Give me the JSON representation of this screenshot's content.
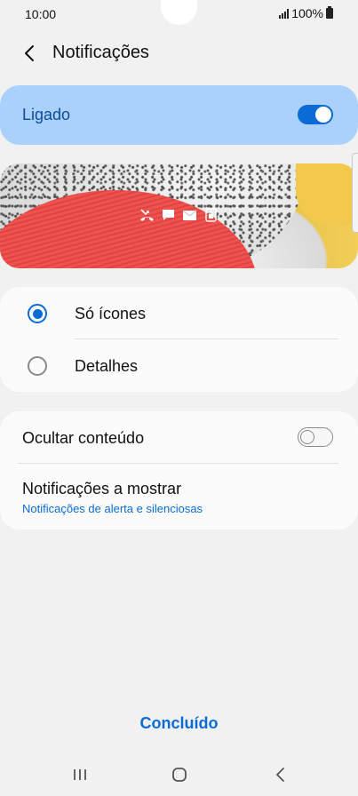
{
  "status_bar": {
    "time": "10:00",
    "battery_text": "100%",
    "signal_icon": "signal-icon",
    "battery_icon": "battery-icon"
  },
  "header": {
    "title": "Notificações",
    "back_icon": "back-arrow-icon"
  },
  "master_switch": {
    "label": "Ligado",
    "state": "on",
    "accent": "#0b6bd6",
    "background": "#a9d1fb"
  },
  "preview": {
    "icons": [
      "missed-call-icon",
      "chat-icon",
      "email-icon",
      "lock-icon"
    ]
  },
  "style_options": {
    "items": [
      {
        "label": "Só ícones",
        "checked": true
      },
      {
        "label": "Detalhes",
        "checked": false
      }
    ]
  },
  "settings": {
    "hide_content": {
      "label": "Ocultar conteúdo",
      "state": "off"
    },
    "notifications_to_show": {
      "label": "Notificações a mostrar",
      "value": "Notificações de alerta e silenciosas"
    }
  },
  "footer": {
    "done_label": "Concluído"
  },
  "navbar": {
    "icons": [
      "recent-apps-icon",
      "home-icon",
      "back-icon"
    ]
  }
}
